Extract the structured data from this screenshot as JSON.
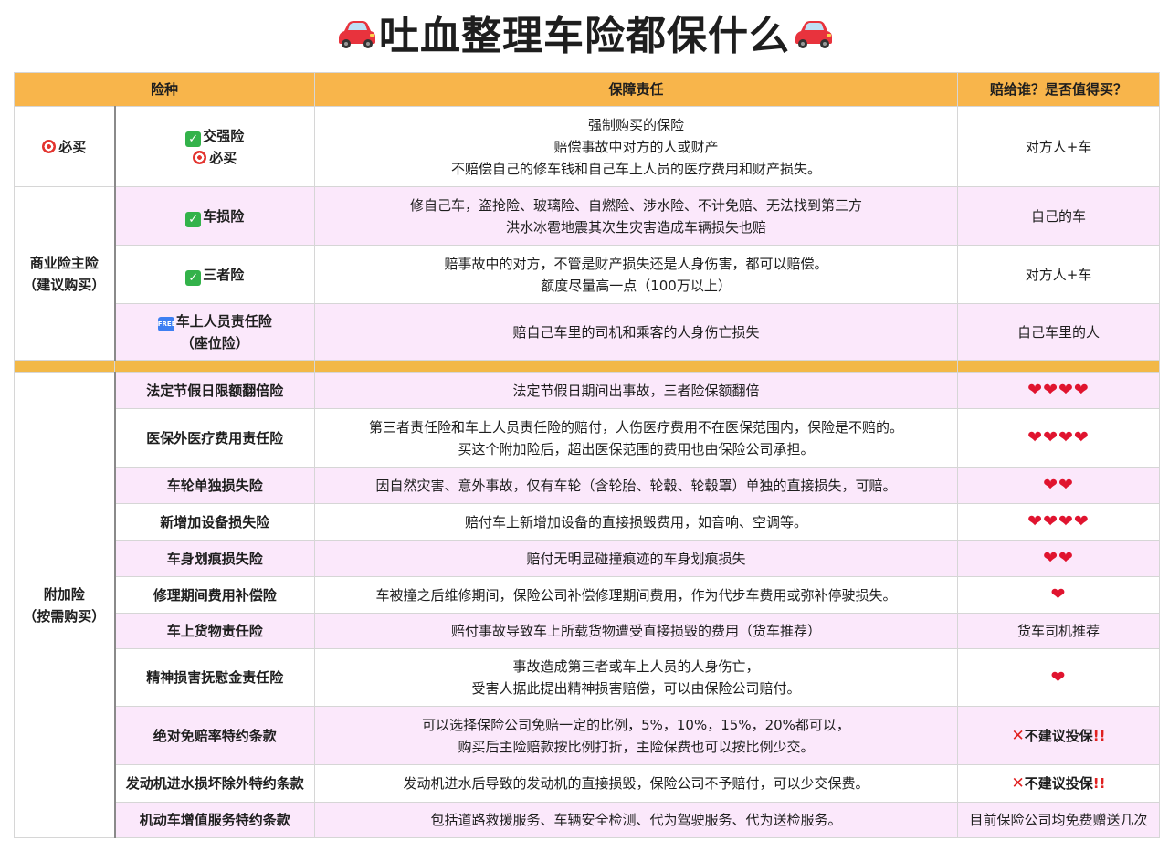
{
  "title": "吐血整理车险都保什么",
  "headers": {
    "type": "险种",
    "coverage": "保障责任",
    "who": "赔给谁？是否值得买？"
  },
  "groups": {
    "must": "必买",
    "commercial_l1": "商业险主险",
    "commercial_l2": "（建议购买）",
    "addon_l1": "附加险",
    "addon_l2": "（按需购买）"
  },
  "rows": {
    "jqx": {
      "name": "交强险",
      "tag": "必买",
      "desc": [
        "强制购买的保险",
        "赔偿事故中对方的人或财产",
        "不赔偿自己的修车钱和自己车上人员的医疗费用和财产损失。"
      ],
      "who": "对方人+车"
    },
    "csx": {
      "name": "车损险",
      "desc": [
        "修自己车，盗抢险、玻璃险、自燃险、涉水险、不计免赔、无法找到第三方",
        "洪水冰雹地震其次生灾害造成车辆损失也赔"
      ],
      "who": "自己的车"
    },
    "szx": {
      "name": "三者险",
      "desc": [
        "赔事故中的对方，不管是财产损失还是人身伤害，都可以赔偿。",
        "额度尽量高一点（100万以上）"
      ],
      "who": "对方人+车"
    },
    "zwx": {
      "name": "车上人员责任险",
      "name2": "（座位险）",
      "free_icon": "FREE",
      "desc": "赔自己车里的司机和乘客的人身伤亡损失",
      "who": "自己车里的人"
    }
  },
  "addons": [
    {
      "name": "法定节假日限额翻倍险",
      "desc": [
        "法定节假日期间出事故，三者险保额翻倍"
      ],
      "rating": 4
    },
    {
      "name": "医保外医疗费用责任险",
      "desc": [
        "第三者责任险和车上人员责任险的赔付，人伤医疗费用不在医保范围内，保险是不赔的。",
        "买这个附加险后，超出医保范围的费用也由保险公司承担。"
      ],
      "rating": 4
    },
    {
      "name": "车轮单独损失险",
      "desc": [
        "因自然灾害、意外事故，仅有车轮（含轮胎、轮毂、轮毂罩）单独的直接损失，可赔。"
      ],
      "rating": 2
    },
    {
      "name": "新增加设备损失险",
      "desc": [
        "赔付车上新增加设备的直接损毁费用，如音响、空调等。"
      ],
      "rating": 4
    },
    {
      "name": "车身划痕损失险",
      "desc": [
        "赔付无明显碰撞痕迹的车身划痕损失"
      ],
      "rating": 2
    },
    {
      "name": "修理期间费用补偿险",
      "desc": [
        "车被撞之后维修期间，保险公司补偿修理期间费用，作为代步车费用或弥补停驶损失。"
      ],
      "rating": 1
    },
    {
      "name": "车上货物责任险",
      "desc": [
        "赔付事故导致车上所载货物遭受直接损毁的费用（货车推荐）"
      ],
      "verdict": "货车司机推荐"
    },
    {
      "name": "精神损害抚慰金责任险",
      "desc": [
        "事故造成第三者或车上人员的人身伤亡，",
        "受害人据此提出精神损害赔偿，可以由保险公司赔付。"
      ],
      "rating": 1
    },
    {
      "name": "绝对免赔率特约条款",
      "desc": [
        "可以选择保险公司免赔一定的比例，5%，10%，15%，20%都可以，",
        "购买后主险赔款按比例打折，主险保费也可以按比例少交。"
      ],
      "verdict": "不建议投保",
      "not_recommended": true
    },
    {
      "name": "发动机进水损坏除外特约条款",
      "desc": [
        "发动机进水后导致的发动机的直接损毁，保险公司不予赔付，可以少交保费。"
      ],
      "verdict": "不建议投保",
      "not_recommended": true
    },
    {
      "name": "机动车增值服务特约条款",
      "desc": [
        "包括道路救援服务、车辆安全检测、代为驾驶服务、代为送检服务。"
      ],
      "verdict": "目前保险公司均免费赠送几次"
    }
  ],
  "icons": {
    "title_left": "red-car-icon",
    "title_right": "red-car-icon",
    "check": "check-mark-icon",
    "target": "target-icon",
    "heart": "heart-icon",
    "cross": "cross-mark-icon",
    "double_bang": "double-exclamation-icon",
    "free": "free-badge-icon"
  },
  "colors": {
    "header": "#f8b54b",
    "pink_row": "#fbe8fb",
    "separator": "#f2b847",
    "heart": "#e0142f",
    "cross": "#e02020"
  }
}
